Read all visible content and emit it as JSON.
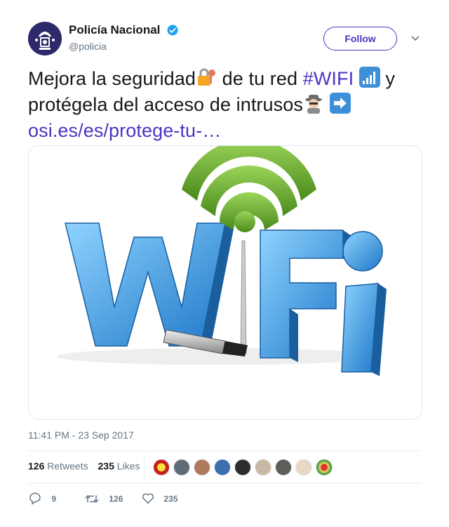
{
  "user": {
    "display_name": "Policía Nacional",
    "handle": "@policia",
    "follow_label": "Follow"
  },
  "tweet": {
    "text_part1": "Mejora la seguridad",
    "text_part2": " de tu red ",
    "hashtag": "#WIFI",
    "text_part3": " y protégela del acceso de intrusos",
    "link": "osi.es/es/protege-tu-…",
    "timestamp": "11:41 PM - 23 Sep 2017"
  },
  "media": {
    "wifi_letters": [
      "W",
      "F",
      "i"
    ]
  },
  "stats": {
    "retweets_count": "126",
    "retweets_label": "Retweets",
    "likes_count": "235",
    "likes_label": "Likes"
  },
  "actions": {
    "replies": "9",
    "retweets": "126",
    "likes": "235"
  },
  "colors": {
    "accent": "#4a35c2",
    "wifi_blue": "#3ba2e6",
    "wifi_green": "#5fa521"
  },
  "icons": [
    "verified-icon",
    "chevron-down-icon",
    "lock-key-icon",
    "antenna-bars-icon",
    "detective-icon",
    "right-arrow-icon",
    "reply-icon",
    "retweet-icon",
    "heart-icon"
  ]
}
